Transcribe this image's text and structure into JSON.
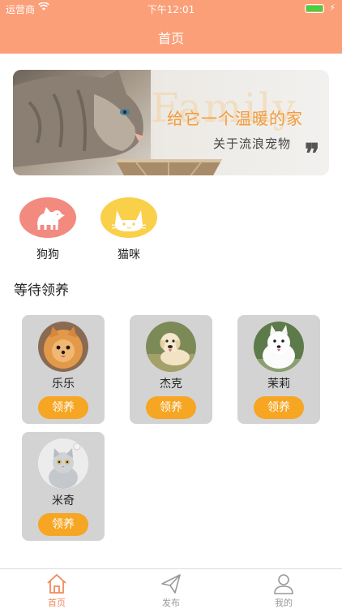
{
  "status_bar": {
    "carrier": "运营商",
    "time": "下午12:01"
  },
  "nav": {
    "title": "首页"
  },
  "banner": {
    "background_word": "Family",
    "title": "给它一个温暖的家",
    "subtitle": "关于流浪宠物",
    "quote_mark": "❞"
  },
  "categories": [
    {
      "label": "狗狗",
      "color": "#f28a80",
      "icon": "dog-icon"
    },
    {
      "label": "猫咪",
      "color": "#fad04a",
      "icon": "cat-icon"
    }
  ],
  "section": {
    "title": "等待领养"
  },
  "pets": [
    {
      "name": "乐乐",
      "button": "领养",
      "photo": "pomeranian-photo"
    },
    {
      "name": "杰克",
      "button": "领养",
      "photo": "labrador-photo"
    },
    {
      "name": "茉莉",
      "button": "领养",
      "photo": "samoyed-photo"
    },
    {
      "name": "米奇",
      "button": "领养",
      "photo": "cat-photo"
    }
  ],
  "tabbar": {
    "items": [
      {
        "label": "首页",
        "icon": "home-icon",
        "active": true
      },
      {
        "label": "发布",
        "icon": "send-icon",
        "active": false
      },
      {
        "label": "我的",
        "icon": "user-icon",
        "active": false
      }
    ]
  },
  "colors": {
    "header": "#fb9f78",
    "accent_button": "#f6a623",
    "tab_active": "#f08a5d",
    "tab_inactive": "#999999"
  }
}
